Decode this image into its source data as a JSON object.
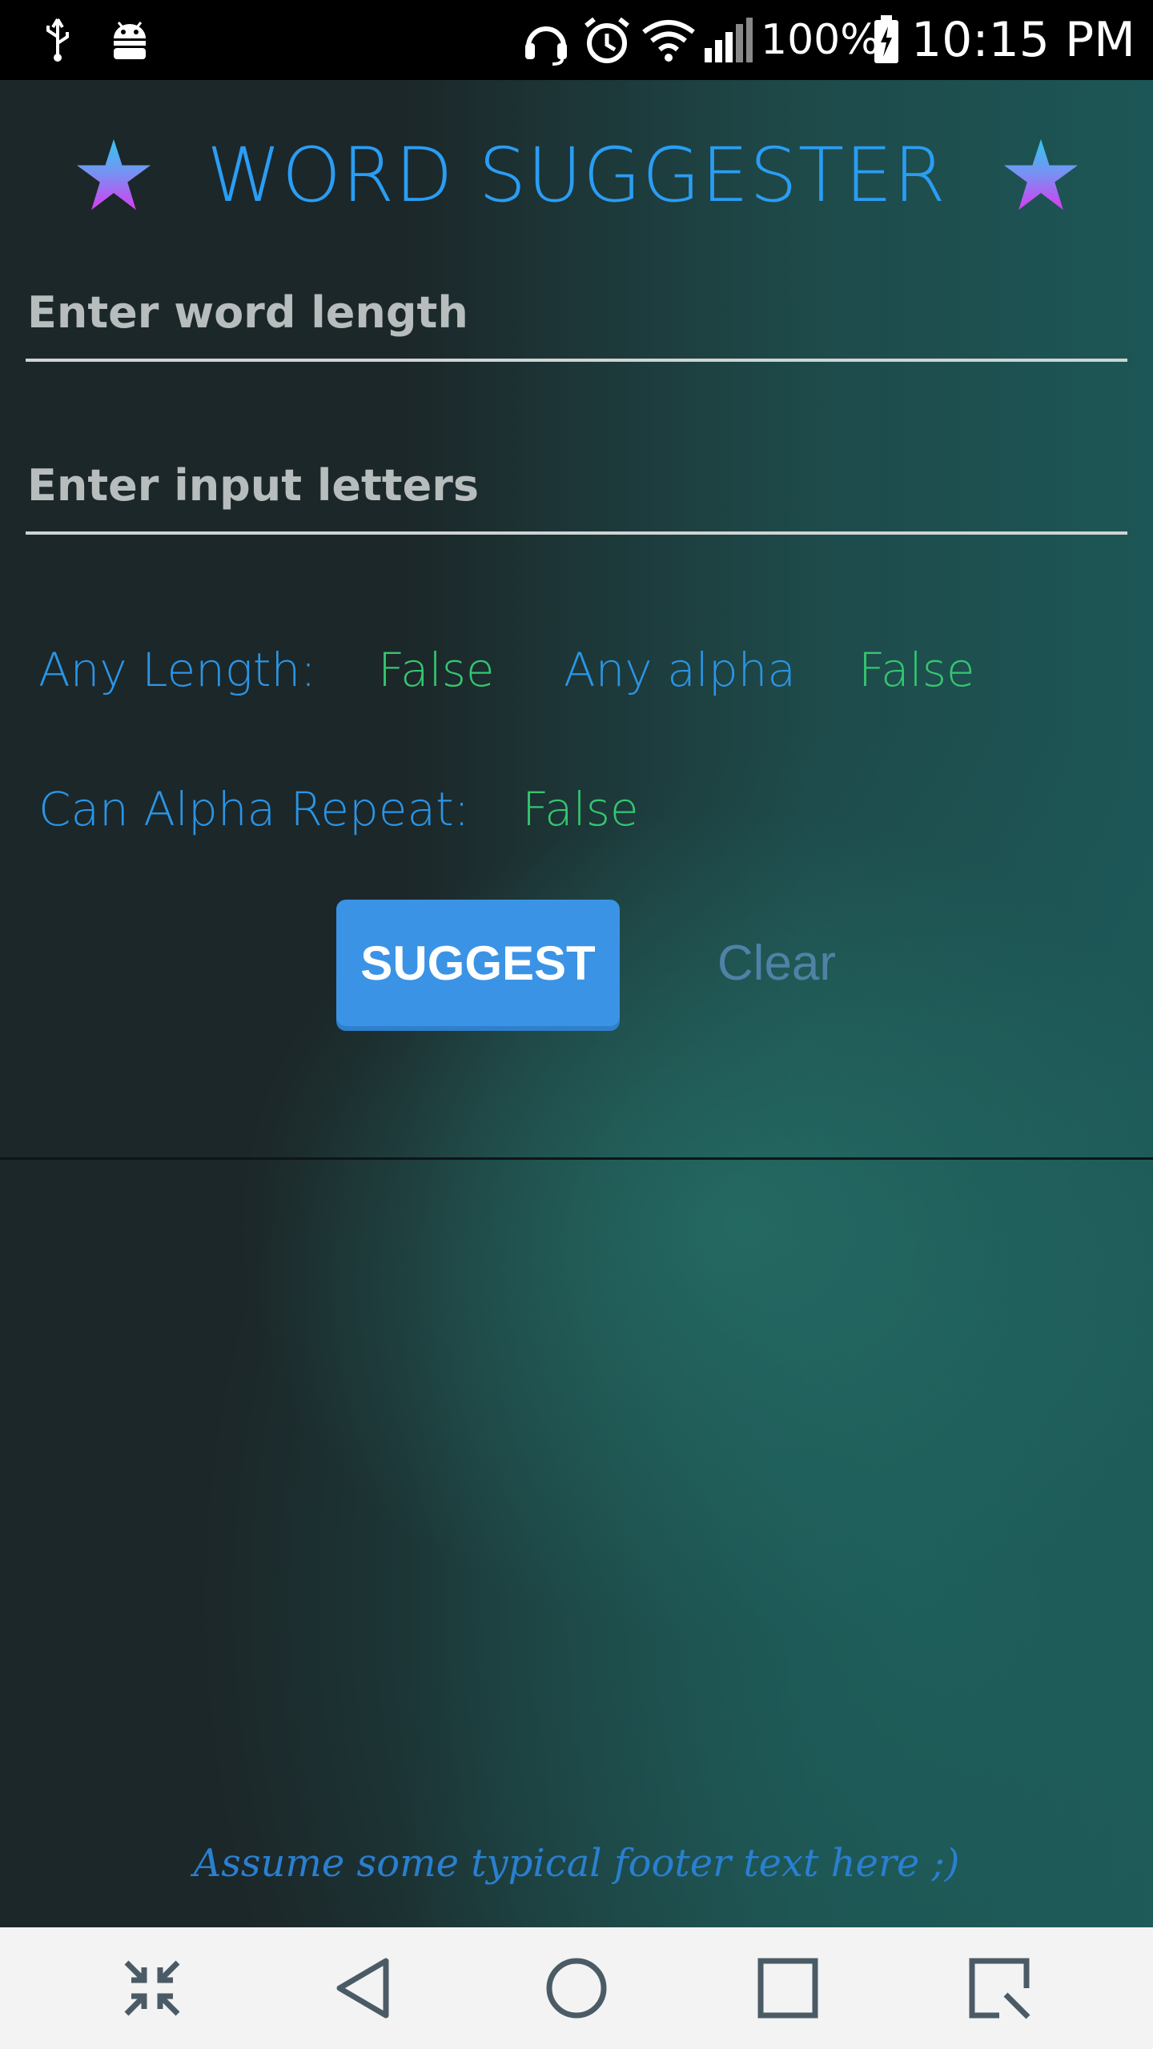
{
  "status_bar": {
    "battery_percent": "100%",
    "time": "10:15 PM",
    "icons": [
      "usb-icon",
      "android-debug-icon",
      "headset-icon",
      "alarm-icon",
      "wifi-icon",
      "signal-icon",
      "battery-charging-icon"
    ]
  },
  "app": {
    "title": "WORD SUGGESTER",
    "word_length_placeholder": "Enter word length",
    "word_length_value": "",
    "input_letters_placeholder": "Enter input letters",
    "input_letters_value": "",
    "any_length_label": "Any Length:",
    "any_length_value": "False",
    "any_alpha_label": "Any alpha",
    "any_alpha_value": "False",
    "alpha_repeat_label": "Can Alpha Repeat:",
    "alpha_repeat_value": "False",
    "suggest_label": "SUGGEST",
    "clear_label": "Clear",
    "footer_text": "Assume some typical footer text here ;)"
  },
  "nav_bar": {
    "icons": [
      "collapse-icon",
      "back-icon",
      "home-icon",
      "recents-icon",
      "capture-icon"
    ]
  },
  "colors": {
    "accent_blue": "#2a9df4",
    "toggle_green": "#34c76f",
    "button_blue": "#3b93e5"
  }
}
